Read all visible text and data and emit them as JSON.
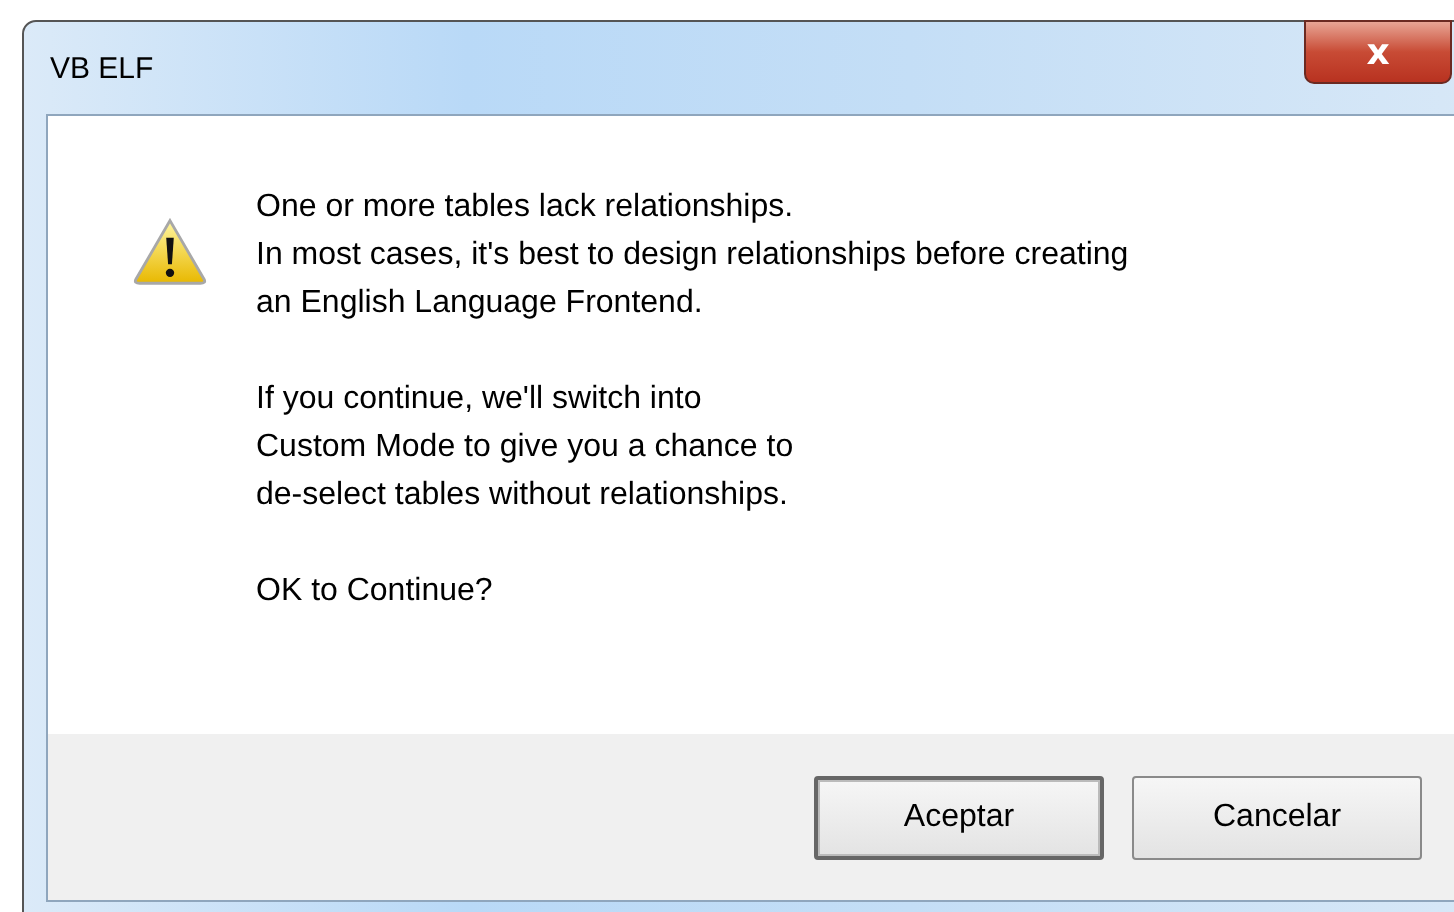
{
  "window": {
    "title": "VB ELF",
    "close": "x"
  },
  "message": {
    "paragraphs": [
      [
        "One or more tables lack relationships.",
        "In most cases, it's best to design relationships before creating",
        "an English Language Frontend."
      ],
      [
        "If you continue, we'll switch into",
        "Custom Mode to give you a chance to",
        "de-select tables without relationships."
      ],
      [
        "OK to Continue?"
      ]
    ]
  },
  "buttons": [
    {
      "label": "Aceptar",
      "default": true
    },
    {
      "label": "Cancelar",
      "default": false
    }
  ]
}
